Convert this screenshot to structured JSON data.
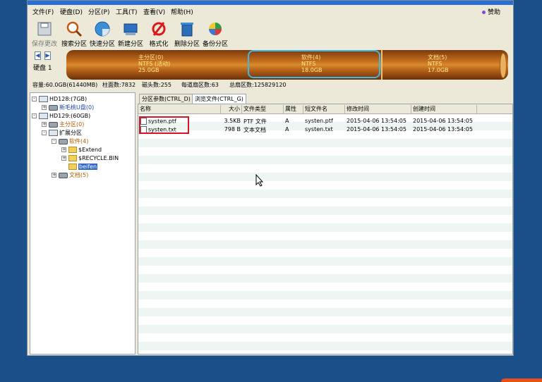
{
  "menu": [
    "文件(F)",
    "硬盘(D)",
    "分区(P)",
    "工具(T)",
    "查看(V)",
    "帮助(H)"
  ],
  "help_button": "赞助",
  "toolbar": [
    {
      "label": "保存更改",
      "icon": "save-icon",
      "enabled": false
    },
    {
      "label": "搜索分区",
      "icon": "search-icon",
      "enabled": true
    },
    {
      "label": "快速分区",
      "icon": "quick-partition-icon",
      "enabled": true
    },
    {
      "label": "新建分区",
      "icon": "new-partition-icon",
      "enabled": true
    },
    {
      "label": "格式化",
      "icon": "format-icon",
      "enabled": true
    },
    {
      "label": "删除分区",
      "icon": "delete-partition-icon",
      "enabled": true
    },
    {
      "label": "备份分区",
      "icon": "backup-partition-icon",
      "enabled": true
    }
  ],
  "disk": {
    "label": "硬盘 1",
    "segments": [
      {
        "name": "主分区(0)",
        "fs": "NTFS (活动)",
        "size": "25.0GB"
      },
      {
        "name": "软件(4)",
        "fs": "NTFS",
        "size": "18.0GB"
      },
      {
        "name": "文档(5)",
        "fs": "NTFS",
        "size": "17.0GB"
      }
    ],
    "info": {
      "capacity": "容量:60.0GB(61440MB)",
      "cylinders": "柱面数:7832",
      "heads": "磁头数:255",
      "sectors": "每道扇区数:63",
      "total_sectors": "总扇区数:125829120"
    }
  },
  "tree": {
    "hd0": "HD128:(7GB)",
    "hd0_child": "新毛桃U盘(0)",
    "hd1": "HD129:(60GB)",
    "primary": "主分区(0)",
    "extended": "扩展分区",
    "software": "软件(4)",
    "folder1": "$Extend",
    "folder2": "$RECYCLE.BIN",
    "folder3": "beifen",
    "docs": "文档(5)"
  },
  "tabs": [
    "分区参数(CTRL_D)",
    "浏览文件(CTRL_G)"
  ],
  "columns": [
    "名称",
    "大小",
    "文件类型",
    "属性",
    "短文件名",
    "修改时间",
    "创建时间"
  ],
  "files": [
    {
      "name": "systen.ptf",
      "size": "3.5KB",
      "type": "PTF 文件",
      "attr": "A",
      "short": "systen.ptf",
      "modified": "2015-04-06 13:54:05",
      "created": "2015-04-06 13:54:05"
    },
    {
      "name": "systen.txt",
      "size": "798 B",
      "type": "文本文档",
      "attr": "A",
      "short": "systen.txt",
      "modified": "2015-04-06 13:54:05",
      "created": "2015-04-06 13:54:05"
    }
  ]
}
